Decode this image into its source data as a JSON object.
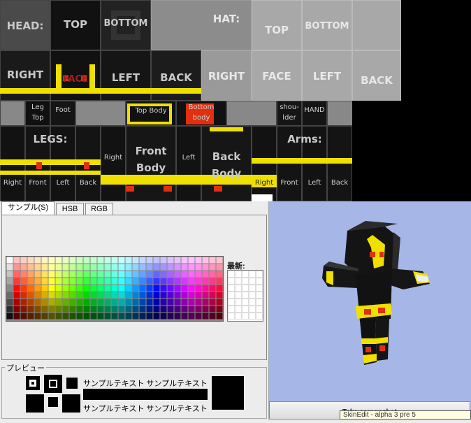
{
  "editor": {
    "head_label": "HEAD:",
    "head_top": "TOP",
    "head_bottom": "BOTTOM",
    "head_right": "RIGHT",
    "head_face": "FACE",
    "head_left": "LEFT",
    "head_back": "BACK",
    "hat_label": "HAT:",
    "hat_top": "TOP",
    "hat_bottom": "BOTTOM",
    "hat_right": "RIGHT",
    "hat_face": "FACE",
    "hat_left": "LEFT",
    "hat_back": "BACK",
    "leg_top": "Leg Top",
    "foot": "Foot",
    "top_body": "Top Body",
    "bottom_body": "Bottom body",
    "shoulder": "shou-lder",
    "hand": "HAND",
    "legs_label": "LEGS:",
    "leg_right": "Right",
    "leg_front": "Front",
    "leg_left": "Left",
    "leg_back": "Back",
    "body_right": "Right",
    "body_front": "Front Body",
    "body_left": "Left",
    "body_back": "Back Body",
    "arms_label": "Arms:",
    "arm_right": "Right",
    "arm_front": "Front",
    "arm_left": "Left",
    "arm_back": "Back"
  },
  "chooser": {
    "tabs": [
      "サンプル(S)",
      "HSB",
      "RGB"
    ],
    "recent_label": "最新:",
    "preview_title": "プレビュー",
    "sample_text_1": "サンプルテキスト  サンプルテキスト",
    "sample_text_2": "サンプルテキスト  サンプルテキスト"
  },
  "viewer": {
    "screenshot_button": "Take screenshot"
  },
  "tooltip": "SkinEdit - alpha 3 pre 5",
  "colors": {
    "skin_yellow": "#f0e000",
    "skin_red": "#e03010",
    "viewer_bg": "#a6b6e6"
  }
}
